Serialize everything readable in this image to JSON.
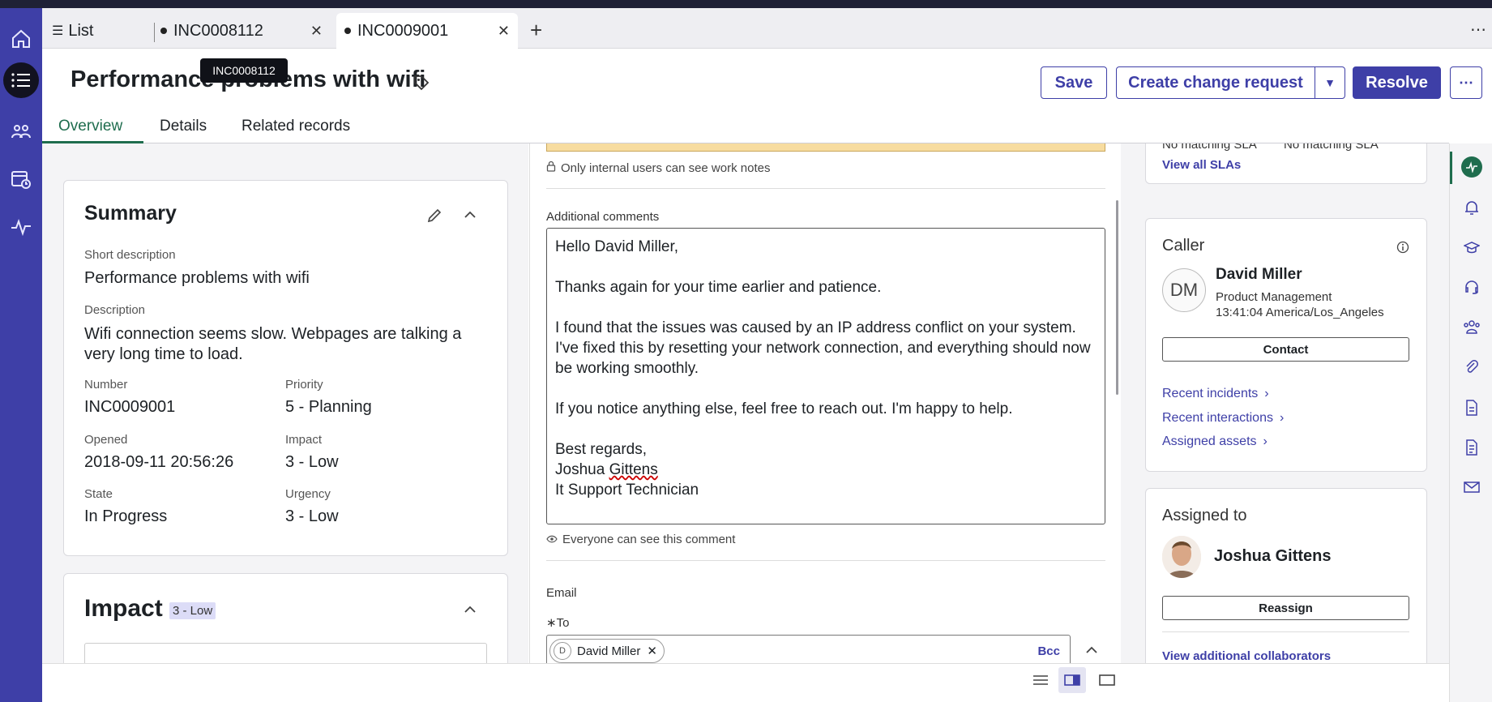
{
  "tabs": [
    {
      "label": "List"
    },
    {
      "label": "INC0008112"
    },
    {
      "label": "INC0009001"
    }
  ],
  "tooltip": "INC0008112",
  "record": {
    "title": "Performance problems with wifi",
    "buttons": {
      "save": "Save",
      "change": "Create change request",
      "resolve": "Resolve"
    },
    "subtabs": [
      "Overview",
      "Details",
      "Related records"
    ]
  },
  "summary": {
    "heading": "Summary",
    "short_desc_label": "Short description",
    "short_desc": "Performance problems with wifi",
    "desc_label": "Description",
    "desc": "Wifi connection seems slow. Webpages are talking a very long time to load.",
    "number_label": "Number",
    "number": "INC0009001",
    "priority_label": "Priority",
    "priority": "5 - Planning",
    "opened_label": "Opened",
    "opened": "2018-09-11 20:56:26",
    "impact_label": "Impact",
    "impact": "3 - Low",
    "state_label": "State",
    "state": "In Progress",
    "urgency_label": "Urgency",
    "urgency": "3 - Low"
  },
  "impact_card": {
    "heading": "Impact",
    "badge": "3 - Low"
  },
  "worknotes_hint": "Only internal users can see work notes",
  "comments": {
    "label": "Additional comments",
    "line1": "Hello David Miller,",
    "line2": "Thanks again for your time earlier and patience.",
    "line3": "I found that the issues was caused by an IP address conflict on your system. I've fixed this by resetting your network connection, and everything should now be working smoothly.",
    "line4": "If you notice anything else, feel free to reach out. I'm happy to help.",
    "line5": "Best regards,",
    "sig_first": "Joshua",
    "sig_last": "Gittens",
    "line7": "It Support Technician",
    "hint": "Everyone can see this comment"
  },
  "email": {
    "label": "Email",
    "to_label": "To",
    "recipient_initial": "D",
    "recipient": "David Miller",
    "bcc": "Bcc"
  },
  "sla": {
    "partial1": "No matching SLA",
    "partial2": "No matching SLA",
    "view_all": "View all SLAs"
  },
  "caller": {
    "heading": "Caller",
    "initials": "DM",
    "name": "David Miller",
    "dept": "Product Management",
    "time": "13:41:04 America/Los_Angeles",
    "contact": "Contact",
    "links": [
      "Recent incidents",
      "Recent interactions",
      "Assigned assets"
    ]
  },
  "assigned": {
    "heading": "Assigned to",
    "name": "Joshua Gittens",
    "reassign": "Reassign",
    "collab": "View additional collaborators"
  },
  "colors": {
    "accent": "#3e3fa7",
    "nav": "#3e3fa7",
    "green": "#1f6d4e",
    "worknotes": "#f7dca0"
  }
}
